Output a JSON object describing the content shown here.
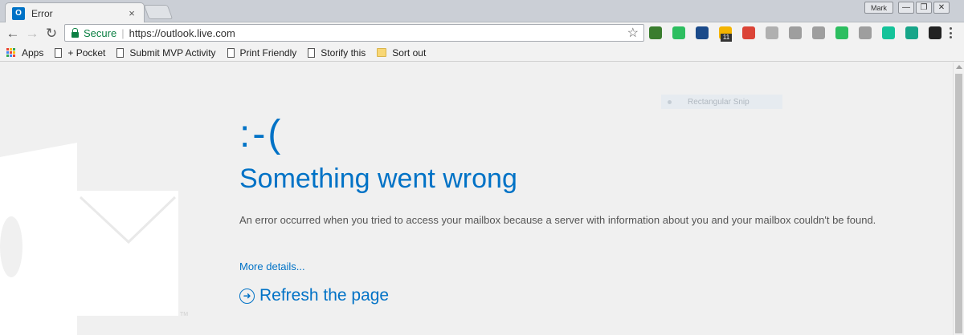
{
  "browser": {
    "tab": {
      "title": "Error",
      "favicon_label": "O"
    },
    "profile_label": "Mark",
    "window_controls": {
      "minimize": "—",
      "restore": "❐",
      "close": "✕"
    },
    "nav": {
      "back": "←",
      "forward": "→",
      "reload": "↻"
    },
    "omnibox": {
      "secure_label": "Secure",
      "separator": "|",
      "url": "https://outlook.live.com"
    },
    "extensions": [
      {
        "name": "extension-green-circle",
        "color": "#3a7d2e"
      },
      {
        "name": "extension-evernote",
        "color": "#2dbe60"
      },
      {
        "name": "extension-v",
        "color": "#1a4a8a"
      },
      {
        "name": "extension-calendar",
        "color": "#f4b400",
        "badge": "11"
      },
      {
        "name": "extension-colorful",
        "color": "#db4437"
      },
      {
        "name": "extension-skype",
        "color": "#b0b0b0"
      },
      {
        "name": "extension-gray",
        "color": "#9e9e9e"
      },
      {
        "name": "extension-a",
        "color": "#9e9e9e"
      },
      {
        "name": "extension-refresh",
        "color": "#2dbe60"
      },
      {
        "name": "extension-camera",
        "color": "#9e9e9e"
      },
      {
        "name": "extension-grammarly",
        "color": "#15c39a"
      },
      {
        "name": "extension-teal",
        "color": "#17a589"
      },
      {
        "name": "extension-dark",
        "color": "#222222"
      }
    ]
  },
  "bookmarks": {
    "apps": "Apps",
    "items": [
      "+ Pocket",
      "Submit MVP Activity",
      "Print Friendly",
      "Storify this",
      "Sort out"
    ]
  },
  "page": {
    "overlay_label": "Rectangular Snip",
    "face": ":-(",
    "headline": "Something went wrong",
    "message": "An error occurred when you tried to access your mailbox because a server with information about you and your mailbox couldn't be found.",
    "details_link": "More details...",
    "refresh_label": "Refresh the page",
    "logo_trademark": "TM"
  },
  "colors": {
    "accent": "#0072c6",
    "secure": "#0b8043",
    "page_bg": "#f0f0f0"
  }
}
